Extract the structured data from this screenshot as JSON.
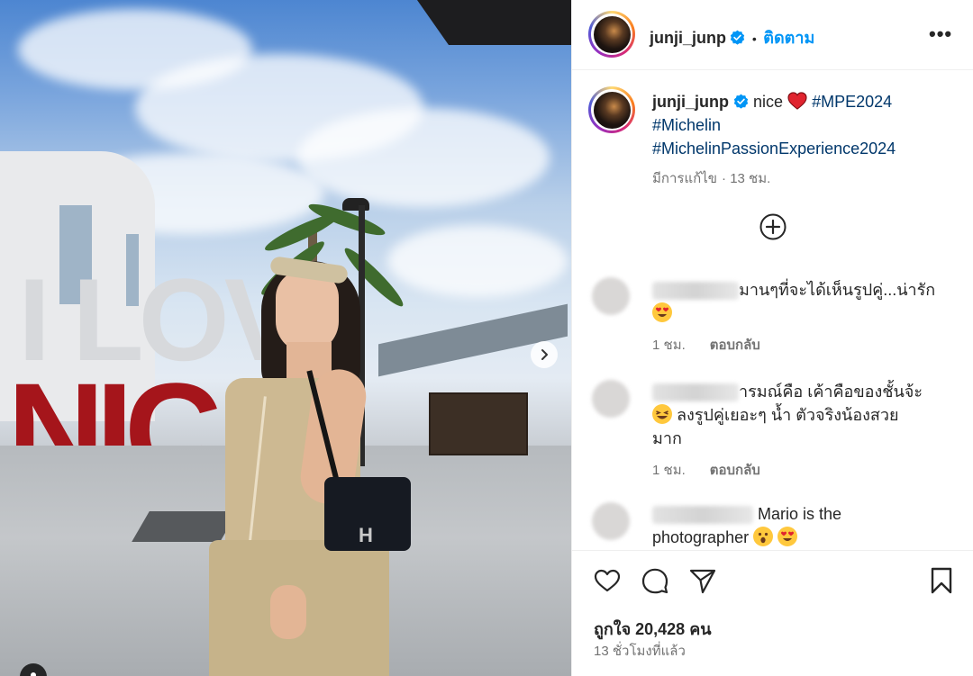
{
  "post": {
    "author": "junji_junp",
    "follow_label": "ติดตาม",
    "separator": "•",
    "more_label": "•••"
  },
  "caption": {
    "username": "junji_junp",
    "text": "nice",
    "hashtags": [
      "#MPE2024",
      "#Michelin",
      "#MichelinPassionExperience2024"
    ],
    "edited_label": "มีการแก้ไข",
    "time": "13 ชม."
  },
  "comments": [
    {
      "text": "มานๆที่จะได้เห็นรูปคู่...น่ารัก",
      "time": "1 ชม.",
      "reply_label": "ตอบกลับ"
    },
    {
      "text_line1": "ารมณ์คือ เค้าคือของชั้นจ้ะ",
      "text_line2": "ลงรูปคู่เยอะๆ น้ำ ตัวจริงน้องสวย",
      "text_line3": "มาก",
      "time": "1 ชม.",
      "reply_label": "ตอบกลับ"
    },
    {
      "text_line1": "Mario is the",
      "text_line2": "photographer"
    }
  ],
  "footer": {
    "likes": "ถูกใจ 20,428 คน",
    "time_ago": "13 ชั่วโมงที่แล้ว"
  },
  "colors": {
    "link": "#0095f6",
    "hashtag": "#00376b",
    "muted": "#737373",
    "text": "#262626"
  },
  "icons": [
    "verified-badge-icon",
    "more-icon",
    "add-circle-icon",
    "heart-icon",
    "comment-icon",
    "share-icon",
    "bookmark-icon",
    "next-arrow-icon",
    "tag-person-icon"
  ]
}
